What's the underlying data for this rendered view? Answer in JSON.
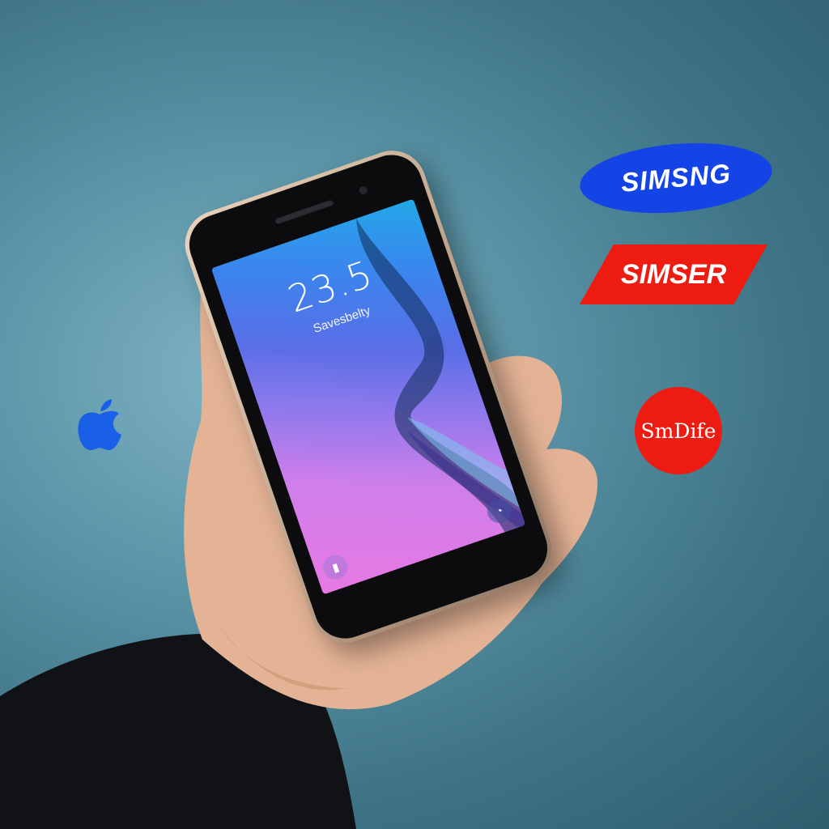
{
  "phone": {
    "lock_time": "23.5",
    "lock_caption": "Savesbelty"
  },
  "logos": {
    "blue_oval": "SIMSNG",
    "red_parallelogram": "SIMSER",
    "red_circle": "SmDife",
    "apple": "apple-logo-icon"
  },
  "colors": {
    "background": "#4d8799",
    "blue_logo": "#1444e6",
    "red_logo": "#ee1c10",
    "apple_logo": "#1a5fe8"
  }
}
